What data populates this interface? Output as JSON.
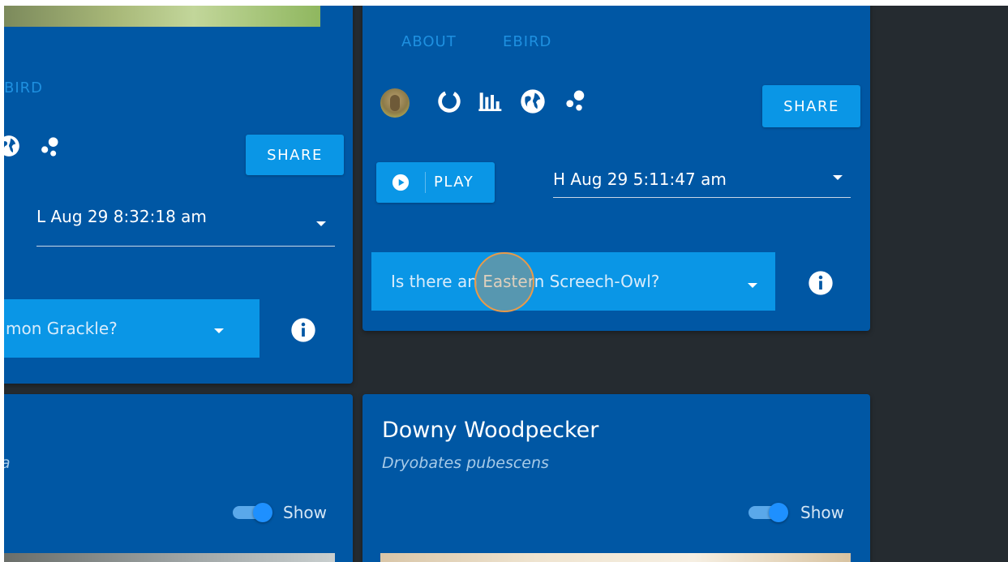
{
  "left_card": {
    "tab_partial": "BIRD",
    "share_label": "SHARE",
    "recording_time": "L Aug 29 8:32:18 am",
    "question": "mon Grackle?"
  },
  "right_card": {
    "tabs": [
      "ABOUT",
      "EBIRD"
    ],
    "share_label": "SHARE",
    "play_label": "PLAY",
    "recording_time": "H Aug 29 5:11:47 am",
    "question": "Is there an Eastern Screech-Owl?"
  },
  "bottom_left_card": {
    "sci_partial": "a",
    "show_label": "Show",
    "toggle_on": true
  },
  "bottom_right_card": {
    "common_name": "Downy Woodpecker",
    "scientific_name": "Dryobates pubescens",
    "show_label": "Show",
    "toggle_on": true
  },
  "colors": {
    "background": "#252b30",
    "card": "#0057a4",
    "accent": "#0a96e6",
    "tab_text": "#1e90e0",
    "cursor_ring": "#e89a4a"
  },
  "icons": [
    "globe-icon",
    "dots-icon",
    "circle-progress-icon",
    "bar-chart-icon",
    "play-circle-icon",
    "info-icon",
    "owl-avatar"
  ]
}
